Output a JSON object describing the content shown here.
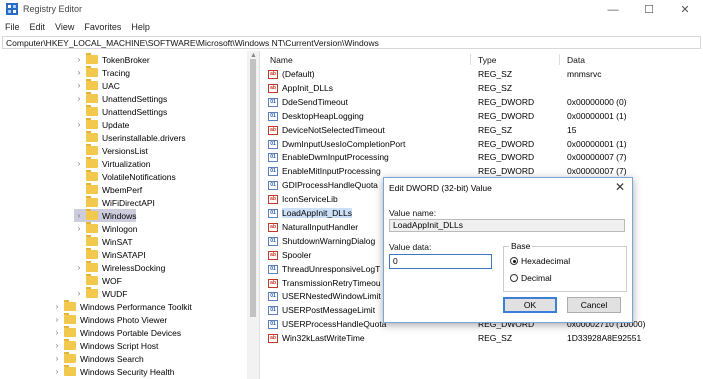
{
  "window": {
    "title": "Registry Editor",
    "minimize": "—",
    "maximize": "☐",
    "close": "✕"
  },
  "menu": [
    "File",
    "Edit",
    "View",
    "Favorites",
    "Help"
  ],
  "address": "Computer\\HKEY_LOCAL_MACHINE\\SOFTWARE\\Microsoft\\Windows NT\\CurrentVersion\\Windows",
  "tree": {
    "items": [
      {
        "label": "TokenBroker",
        "level": 2,
        "arrow": "›"
      },
      {
        "label": "Tracing",
        "level": 2,
        "arrow": "›"
      },
      {
        "label": "UAC",
        "level": 2,
        "arrow": "›"
      },
      {
        "label": "UnattendSettings",
        "level": 2,
        "arrow": "›"
      },
      {
        "label": "UnattendSettings",
        "level": 2,
        "arrow": ""
      },
      {
        "label": "Update",
        "level": 2,
        "arrow": "›"
      },
      {
        "label": "Userinstallable.drivers",
        "level": 2,
        "arrow": ""
      },
      {
        "label": "VersionsList",
        "level": 2,
        "arrow": ""
      },
      {
        "label": "Virtualization",
        "level": 2,
        "arrow": "›"
      },
      {
        "label": "VolatileNotifications",
        "level": 2,
        "arrow": ""
      },
      {
        "label": "WbemPerf",
        "level": 2,
        "arrow": ""
      },
      {
        "label": "WiFiDirectAPI",
        "level": 2,
        "arrow": ""
      },
      {
        "label": "Windows",
        "level": 2,
        "arrow": "›",
        "selected": true
      },
      {
        "label": "Winlogon",
        "level": 2,
        "arrow": "›"
      },
      {
        "label": "WinSAT",
        "level": 2,
        "arrow": ""
      },
      {
        "label": "WinSATAPI",
        "level": 2,
        "arrow": ""
      },
      {
        "label": "WirelessDocking",
        "level": 2,
        "arrow": "›"
      },
      {
        "label": "WOF",
        "level": 2,
        "arrow": ""
      },
      {
        "label": "WUDF",
        "level": 2,
        "arrow": "›"
      },
      {
        "label": "Windows Performance Toolkit",
        "level": 1,
        "arrow": "›"
      },
      {
        "label": "Windows Photo Viewer",
        "level": 1,
        "arrow": "›"
      },
      {
        "label": "Windows Portable Devices",
        "level": 1,
        "arrow": "›"
      },
      {
        "label": "Windows Script Host",
        "level": 1,
        "arrow": "›"
      },
      {
        "label": "Windows Search",
        "level": 1,
        "arrow": "›"
      },
      {
        "label": "Windows Security Health",
        "level": 1,
        "arrow": "›"
      }
    ]
  },
  "list": {
    "headers": {
      "name": "Name",
      "type": "Type",
      "data": "Data"
    },
    "rows": [
      {
        "name": "(Default)",
        "type": "REG_SZ",
        "data": "mnmsrvc",
        "icon": "string-value-icon"
      },
      {
        "name": "AppInit_DLLs",
        "type": "REG_SZ",
        "data": "",
        "icon": "string-value-icon"
      },
      {
        "name": "DdeSendTimeout",
        "type": "REG_DWORD",
        "data": "0x00000000 (0)",
        "icon": "binary-value-icon"
      },
      {
        "name": "DesktopHeapLogging",
        "type": "REG_DWORD",
        "data": "0x00000001 (1)",
        "icon": "binary-value-icon"
      },
      {
        "name": "DeviceNotSelectedTimeout",
        "type": "REG_SZ",
        "data": "15",
        "icon": "string-value-icon"
      },
      {
        "name": "DwmInputUsesIoCompletionPort",
        "type": "REG_DWORD",
        "data": "0x00000001 (1)",
        "icon": "binary-value-icon"
      },
      {
        "name": "EnableDwmInputProcessing",
        "type": "REG_DWORD",
        "data": "0x00000007 (7)",
        "icon": "binary-value-icon"
      },
      {
        "name": "EnableMitInputProcessing",
        "type": "REG_DWORD",
        "data": "0x00000007 (7)",
        "icon": "binary-value-icon"
      },
      {
        "name": "GDIProcessHandleQuota",
        "type": "",
        "data": "000)",
        "icon": "binary-value-icon"
      },
      {
        "name": "IconServiceLib",
        "type": "",
        "data": "ce.dll",
        "icon": "string-value-icon"
      },
      {
        "name": "LoadAppInit_DLLs",
        "type": "",
        "data": "",
        "icon": "binary-value-icon",
        "selected": true
      },
      {
        "name": "NaturalInputHandler",
        "type": "",
        "data": "",
        "icon": "string-value-icon"
      },
      {
        "name": "ShutdownWarningDialog",
        "type": "",
        "data": "67295)",
        "icon": "binary-value-icon"
      },
      {
        "name": "Spooler",
        "type": "",
        "data": "",
        "icon": "string-value-icon"
      },
      {
        "name": "ThreadUnresponsiveLogT",
        "type": "",
        "data": ")",
        "icon": "binary-value-icon"
      },
      {
        "name": "TransmissionRetryTimeou",
        "type": "",
        "data": "",
        "icon": "string-value-icon"
      },
      {
        "name": "USERNestedWindowLimit",
        "type": "",
        "data": "",
        "icon": "binary-value-icon"
      },
      {
        "name": "USERPostMessageLimit",
        "type": "",
        "data": "000)",
        "icon": "binary-value-icon"
      },
      {
        "name": "USERProcessHandleQuota",
        "type": "REG_DWORD",
        "data": "0x00002710 (10000)",
        "icon": "binary-value-icon"
      },
      {
        "name": "Win32kLastWriteTime",
        "type": "REG_SZ",
        "data": "1D33928A8E92551",
        "icon": "string-value-icon"
      }
    ]
  },
  "dialog": {
    "title": "Edit DWORD (32-bit) Value",
    "close": "✕",
    "value_name_label": "Value name:",
    "value_name": "LoadAppInit_DLLs",
    "value_data_label": "Value data:",
    "value_data": "0",
    "base_label": "Base",
    "hex_label": "Hexadecimal",
    "dec_label": "Decimal",
    "ok": "OK",
    "cancel": "Cancel"
  }
}
